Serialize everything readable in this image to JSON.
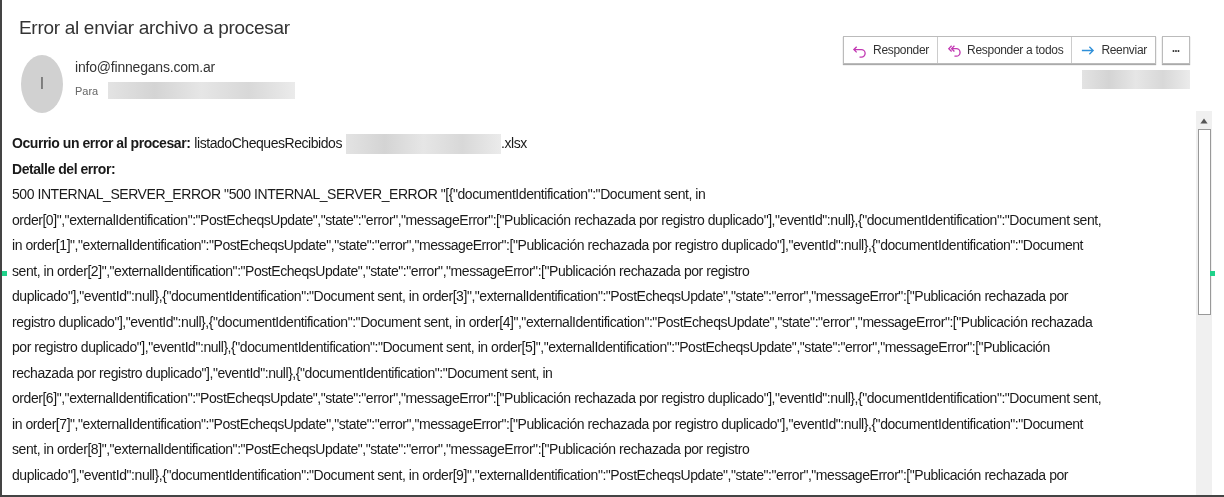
{
  "subject": "Error al enviar archivo a procesar",
  "sender": {
    "initial": "I",
    "email": "info@finnegans.com.ar",
    "to_label": "Para"
  },
  "actions": [
    {
      "kind": "reply",
      "label": "Responder"
    },
    {
      "kind": "reply_all",
      "label": "Responder a todos"
    },
    {
      "kind": "forward",
      "label": "Reenviar"
    }
  ],
  "more_button": "•••",
  "body": {
    "file_label": "Ocurrio un error al procesar:",
    "file_name": "listadoChequesRecibidos",
    "file_ext": ".xlsx",
    "detail_label": "Detalle del error:",
    "lines": [
      "500 INTERNAL_SERVER_ERROR \"500 INTERNAL_SERVER_ERROR \"[{\"documentIdentification\":\"Document sent, in",
      "order[0]\",\"externalIdentification\":\"PostEcheqsUpdate\",\"state\":\"error\",\"messageError\":[\"Publicación rechazada por registro duplicado\"],\"eventId\":null},{\"documentIdentification\":\"Document sent,",
      "in order[1]\",\"externalIdentification\":\"PostEcheqsUpdate\",\"state\":\"error\",\"messageError\":[\"Publicación rechazada por registro duplicado\"],\"eventId\":null},{\"documentIdentification\":\"Document",
      "sent, in order[2]\",\"externalIdentification\":\"PostEcheqsUpdate\",\"state\":\"error\",\"messageError\":[\"Publicación rechazada por registro",
      "duplicado\"],\"eventId\":null},{\"documentIdentification\":\"Document sent, in order[3]\",\"externalIdentification\":\"PostEcheqsUpdate\",\"state\":\"error\",\"messageError\":[\"Publicación rechazada por",
      "registro duplicado\"],\"eventId\":null},{\"documentIdentification\":\"Document sent, in order[4]\",\"externalIdentification\":\"PostEcheqsUpdate\",\"state\":\"error\",\"messageError\":[\"Publicación rechazada",
      "por registro duplicado\"],\"eventId\":null},{\"documentIdentification\":\"Document sent, in order[5]\",\"externalIdentification\":\"PostEcheqsUpdate\",\"state\":\"error\",\"messageError\":[\"Publicación",
      "rechazada por registro duplicado\"],\"eventId\":null},{\"documentIdentification\":\"Document sent, in",
      "order[6]\",\"externalIdentification\":\"PostEcheqsUpdate\",\"state\":\"error\",\"messageError\":[\"Publicación rechazada por registro duplicado\"],\"eventId\":null},{\"documentIdentification\":\"Document sent,",
      "in order[7]\",\"externalIdentification\":\"PostEcheqsUpdate\",\"state\":\"error\",\"messageError\":[\"Publicación rechazada por registro duplicado\"],\"eventId\":null},{\"documentIdentification\":\"Document",
      "sent, in order[8]\",\"externalIdentification\":\"PostEcheqsUpdate\",\"state\":\"error\",\"messageError\":[\"Publicación rechazada por registro",
      "duplicado\"],\"eventId\":null},{\"documentIdentification\":\"Document sent, in order[9]\",\"externalIdentification\":\"PostEcheqsUpdate\",\"state\":\"error\",\"messageError\":[\"Publicación rechazada por"
    ]
  }
}
